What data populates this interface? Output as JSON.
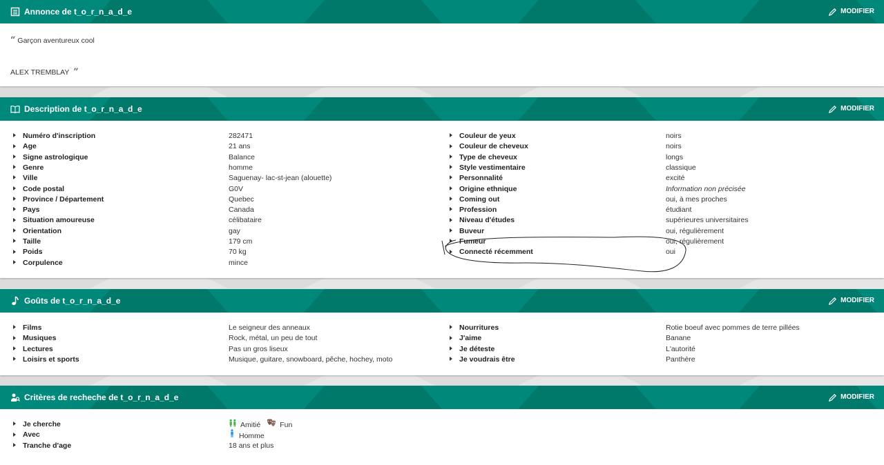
{
  "colors": {
    "header": "#00897b",
    "header_dark": "#00796b"
  },
  "annonce": {
    "title_prefix": "Annonce de ",
    "username": "t_o_r_n_a_d_e",
    "edit_label": "MODIFIER",
    "quote_text": "Garçon aventureux cool",
    "quote_author": "ALEX TREMBLAY",
    "icon": "document-icon"
  },
  "description": {
    "title_prefix": "Description de ",
    "username": "t_o_r_n_a_d_e",
    "edit_label": "MODIFIER",
    "icon": "book-icon",
    "left": [
      {
        "label": "Numéro d'inscription",
        "value": "282471"
      },
      {
        "label": "Age",
        "value": "21 ans"
      },
      {
        "label": "Signe astrologique",
        "value": "Balance"
      },
      {
        "label": "Genre",
        "value": "homme"
      },
      {
        "label": "Ville",
        "value": "Saguenay- lac-st-jean (alouette)"
      },
      {
        "label": "Code postal",
        "value": "G0V"
      },
      {
        "label": "Province / Département",
        "value": "Quebec"
      },
      {
        "label": "Pays",
        "value": "Canada"
      },
      {
        "label": "Situation amoureuse",
        "value": "célibataire"
      },
      {
        "label": "Orientation",
        "value": "gay"
      },
      {
        "label": "Taille",
        "value": "179 cm"
      },
      {
        "label": "Poids",
        "value": "70 kg"
      },
      {
        "label": "Corpulence",
        "value": "mince"
      }
    ],
    "right": [
      {
        "label": "Couleur de yeux",
        "value": "noirs"
      },
      {
        "label": "Couleur de cheveux",
        "value": "noirs"
      },
      {
        "label": "Type de cheveux",
        "value": "longs"
      },
      {
        "label": "Style vestimentaire",
        "value": "classique"
      },
      {
        "label": "Personnalité",
        "value": "excité"
      },
      {
        "label": "Origine ethnique",
        "value": "Information non précisée",
        "italic": true
      },
      {
        "label": "Coming out",
        "value": "oui, à mes proches"
      },
      {
        "label": "Profession",
        "value": "étudiant"
      },
      {
        "label": "Niveau d'études",
        "value": "supérieures universitaires"
      },
      {
        "label": "Buveur",
        "value": "oui, régulièrement"
      },
      {
        "label": "Fumeur",
        "value": "oui, régulièrement"
      },
      {
        "label": "Connecté récemment",
        "value": "oui"
      }
    ]
  },
  "gouts": {
    "title_prefix": "Goûts de ",
    "username": "t_o_r_n_a_d_e",
    "edit_label": "MODIFIER",
    "icon": "music-note-icon",
    "left": [
      {
        "label": "Films",
        "value": "Le seigneur des anneaux"
      },
      {
        "label": "Musiques",
        "value": "Rock, métal, un peu de tout"
      },
      {
        "label": "Lectures",
        "value": "Pas un gros liseux"
      },
      {
        "label": "Loisirs et sports",
        "value": "Musique, guitare, snowboard, pêche, hochey, moto"
      }
    ],
    "right": [
      {
        "label": "Nourritures",
        "value": "Rotie boeuf avec pommes de terre pillées"
      },
      {
        "label": "J'aime",
        "value": "Banane"
      },
      {
        "label": "Je déteste",
        "value": "L'autorité"
      },
      {
        "label": "Je voudrais être",
        "value": "Panthère"
      }
    ]
  },
  "criteres": {
    "title_prefix": "Critères de recheche de ",
    "username": "t_o_r_n_a_d_e",
    "edit_label": "MODIFIER",
    "icon": "search-person-icon",
    "rows": [
      {
        "label": "Je cherche",
        "items": [
          {
            "icon": "friends-icon",
            "text": "Amitié"
          },
          {
            "icon": "theater-masks-icon",
            "text": "Fun"
          }
        ]
      },
      {
        "label": "Avec",
        "items": [
          {
            "icon": "man-icon",
            "text": "Homme"
          }
        ]
      },
      {
        "label": "Tranche d'age",
        "value": "18 ans et plus"
      }
    ]
  }
}
